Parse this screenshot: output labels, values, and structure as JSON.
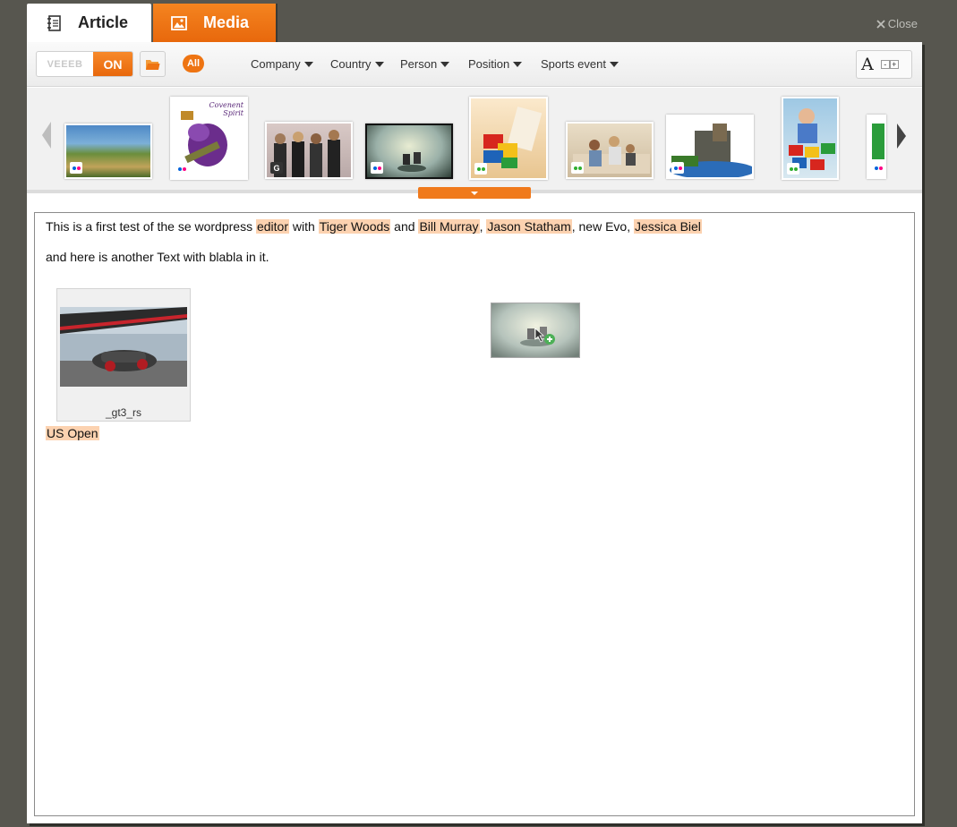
{
  "tabs": {
    "article": {
      "label": "Article",
      "icon": "notebook-icon"
    },
    "media": {
      "label": "Media",
      "icon": "image-icon"
    }
  },
  "close_label": "Close",
  "toolbar": {
    "toggle_off": "VEEEB",
    "toggle_on": "ON",
    "all_label": "All",
    "filters": [
      "Company",
      "Country",
      "Person",
      "Position",
      "Sports event"
    ],
    "font_glyph": "A",
    "font_minus": "-",
    "font_plus": "+"
  },
  "media_strip": {
    "items": [
      {
        "subject": "game-scene",
        "source": "flickr"
      },
      {
        "subject": "covenant-spirit-art",
        "source": "flickr",
        "text": "Covenent Spirit"
      },
      {
        "subject": "group-photo",
        "source": "getty"
      },
      {
        "subject": "bikers-landscape",
        "source": "flickr"
      },
      {
        "subject": "lego-bricks-scroll",
        "source": "other"
      },
      {
        "subject": "family-sofa",
        "source": "other"
      },
      {
        "subject": "lego-castle",
        "source": "flickr"
      },
      {
        "subject": "child-playing-blocks",
        "source": "other"
      },
      {
        "subject": "green-figure",
        "source": "flickr"
      }
    ],
    "colors": {
      "flickr_pink": "#ff0084",
      "flickr_blue": "#0063dc",
      "other_green": "#2fae2f",
      "accent": "#ee7412"
    }
  },
  "editor": {
    "line1": {
      "t1": "This is a first test of the se wordpress ",
      "h1": "editor",
      "t2": " with ",
      "h2": "Tiger Woods",
      "t3": " and ",
      "h3": "Bill Murray",
      "t4": ", ",
      "h4": "Jason Statham",
      "t5": ", new Evo, ",
      "h5": "Jessica Biel"
    },
    "line2": "and here is another Text with blabla in it.",
    "figure_caption": "_gt3_rs",
    "line3": "US Open"
  }
}
